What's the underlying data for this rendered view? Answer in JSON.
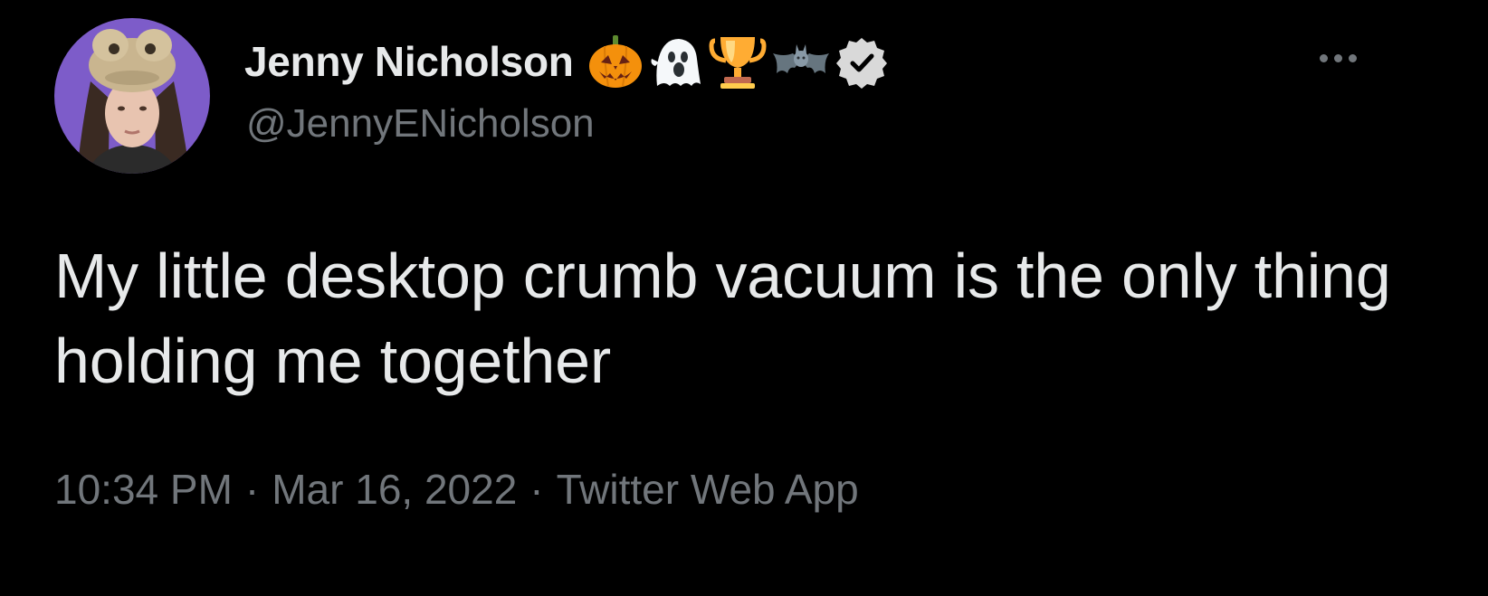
{
  "author": {
    "display_name": "Jenny Nicholson",
    "handle": "@JennyENicholson",
    "name_emojis": [
      "jack-o-lantern",
      "ghost",
      "trophy",
      "bat"
    ],
    "verified": true
  },
  "tweet": {
    "text": "My little desktop crumb vacuum is the only thing holding me together"
  },
  "meta": {
    "time": "10:34 PM",
    "separator": "·",
    "date": "Mar 16, 2022",
    "source": "Twitter Web App"
  },
  "colors": {
    "background": "#000000",
    "primary_text": "#e7e9ea",
    "secondary_text": "#71767b",
    "avatar_bg": "#7d5cc9"
  }
}
